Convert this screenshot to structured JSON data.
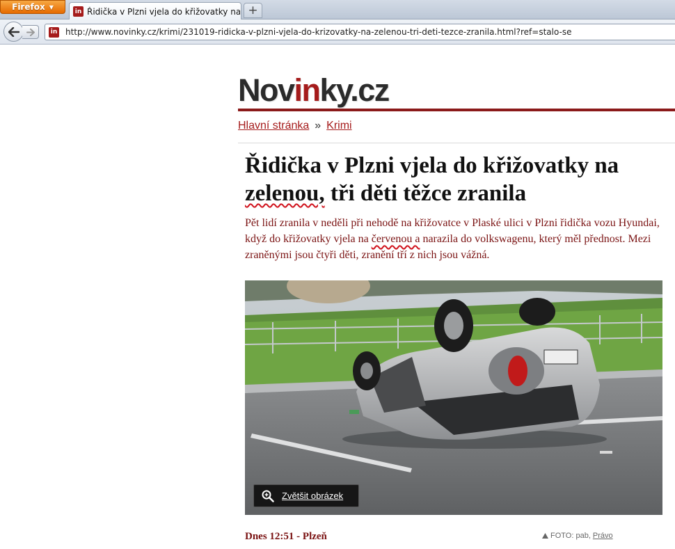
{
  "browser": {
    "menu_button": "Firefox",
    "tab_title": "Řidička v Plzni vjela do křižovatky na zel...",
    "favicon_text": "in",
    "new_tab": "+",
    "url": "http://www.novinky.cz/krimi/231019-ridicka-v-plzni-vjela-do-krizovatky-na-zelenou-tri-deti-tezce-zranila.html?ref=stalo-se"
  },
  "site": {
    "logo_part1": "Nov",
    "logo_part2": "in",
    "logo_part3": "ky.cz",
    "brand_color": "#a51b1b"
  },
  "breadcrumb": {
    "home": "Hlavní stránka",
    "separator": "»",
    "section": "Krimi"
  },
  "article": {
    "headline_a": "Řidička v Plzni vjela do křižovatky na ",
    "headline_marked": "zelenou,",
    "headline_b": " tři děti těžce zranila",
    "perex_a": "Pět lidí zranila v neděli při nehodě na křižovatce v Plaské ulici v Plzni řidička vozu Hyundai, když do křižovatky vjela na ",
    "perex_marked": "červenou a",
    "perex_b": " narazila do volkswagenu, který měl přednost. Mezi zraněnými jsou čtyři děti, zranění tří z nich jsou vážná.",
    "zoom_label": "Zvětšit obrázek",
    "dateline": "Dnes 12:51 - Plzeň",
    "credit_prefix": "FOTO: pab,",
    "credit_link": "Právo"
  }
}
